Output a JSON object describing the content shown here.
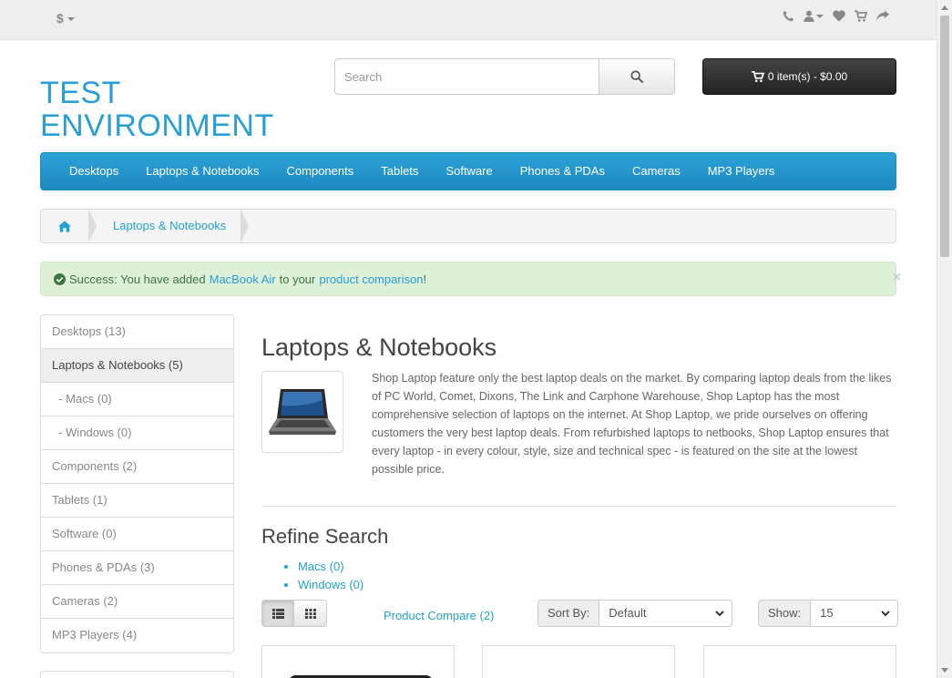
{
  "topbar": {
    "currency": "$",
    "icons": [
      "phone-icon",
      "user-icon",
      "heart-icon",
      "cart-icon",
      "share-icon"
    ]
  },
  "header": {
    "logo": "TEST ENVIRONMENT",
    "search_placeholder": "Search",
    "cart_label": "0 item(s) - $0.00"
  },
  "menu": {
    "items": [
      "Desktops",
      "Laptops & Notebooks",
      "Components",
      "Tablets",
      "Software",
      "Phones & PDAs",
      "Cameras",
      "MP3 Players"
    ]
  },
  "breadcrumb": {
    "current": "Laptops & Notebooks"
  },
  "alert": {
    "prefix": "Success: You have added",
    "product": "MacBook Air",
    "middle": "to your",
    "link": "product comparison",
    "suffix": "!",
    "close": "×"
  },
  "sidebar": {
    "items": [
      "Desktops (13)",
      "Laptops & Notebooks (5)",
      "  - Macs (0)",
      "  - Windows (0)",
      "Components (2)",
      "Tablets (1)",
      "Software (0)",
      "Phones & PDAs (3)",
      "Cameras (2)",
      "MP3 Players (4)"
    ]
  },
  "category": {
    "title": "Laptops & Notebooks",
    "description": "Shop Laptop feature only the best laptop deals on the market. By comparing laptop deals from the likes of PC World, Comet, Dixons, The Link and Carphone Warehouse, Shop Laptop has the most comprehensive selection of laptops on the internet. At Shop Laptop, we pride ourselves on offering customers the very best laptop deals. From refurbished laptops to netbooks, Shop Laptop ensures that every laptop - in every colour, style, size and technical spec - is featured on the site at the lowest possible price."
  },
  "refine": {
    "title": "Refine Search",
    "items": [
      "Macs (0)",
      "Windows (0)"
    ]
  },
  "toolbar": {
    "compare": "Product Compare (2)",
    "sort_label": "Sort By:",
    "sort_value": "Default",
    "show_label": "Show:",
    "show_value": "15"
  },
  "colors": {
    "accent": "#2a9fd6",
    "menu": "#229ac8",
    "success_bg": "#dff0d8"
  }
}
